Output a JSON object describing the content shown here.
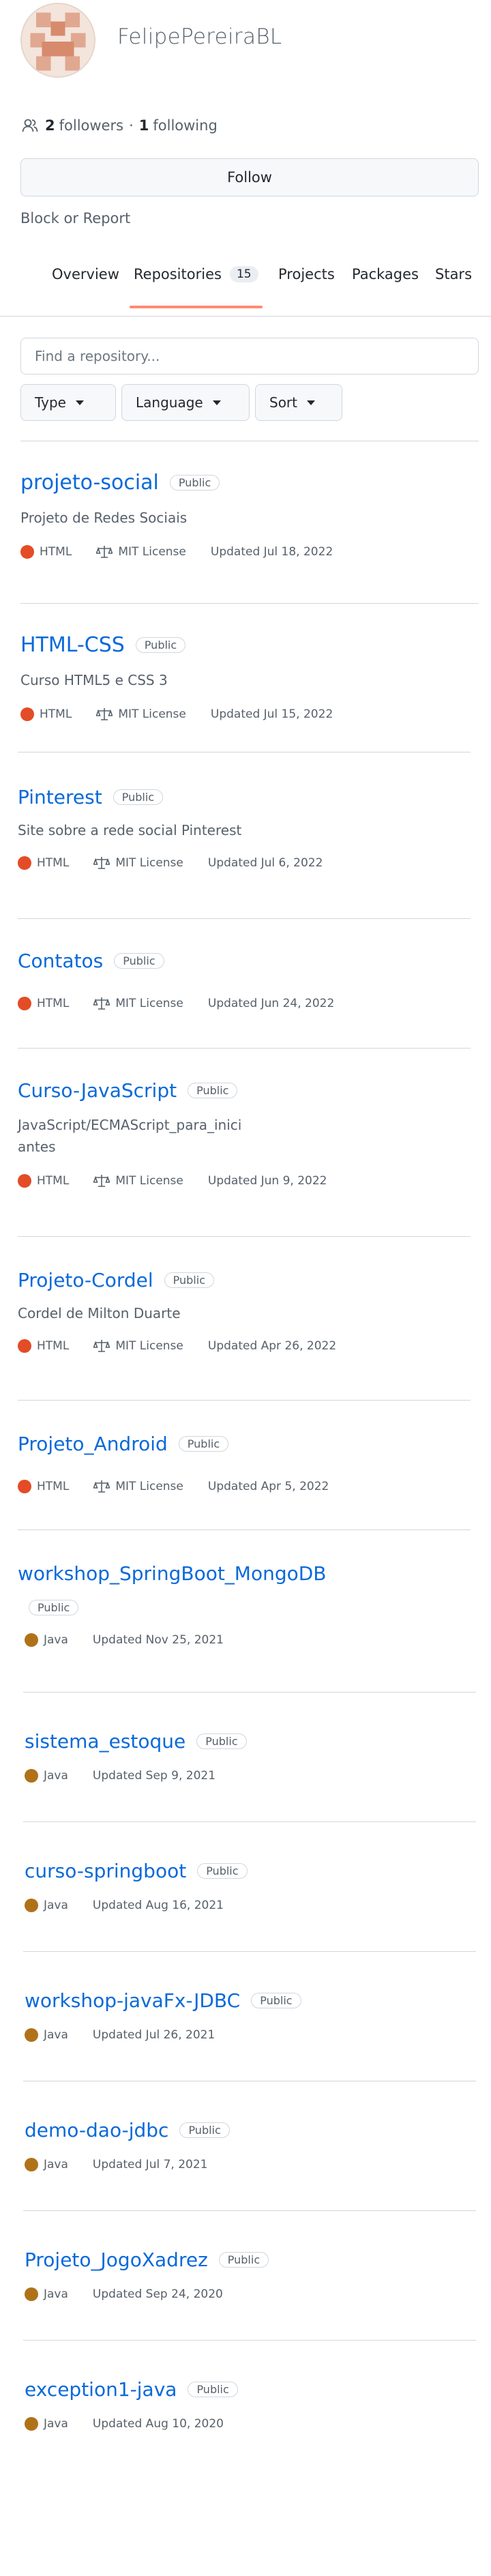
{
  "profile": {
    "username": "FelipePereiraBL",
    "followers_count": "2",
    "followers_label": "followers",
    "following_count": "1",
    "following_label": "following",
    "follow_button": "Follow",
    "block_link": "Block or Report"
  },
  "tabs": [
    {
      "label": "Overview"
    },
    {
      "label": "Repositories",
      "count": "15"
    },
    {
      "label": "Projects"
    },
    {
      "label": "Packages"
    },
    {
      "label": "Stars"
    }
  ],
  "search": {
    "placeholder": "Find a repository..."
  },
  "filters": [
    {
      "label": "Type"
    },
    {
      "label": "Language"
    },
    {
      "label": "Sort"
    }
  ],
  "colors": {
    "accent": "#0969da",
    "html": "#e34c26",
    "java": "#b07219",
    "tab_underline": "#fd8c73"
  },
  "repos": [
    {
      "name": "projeto-social",
      "visibility": "Public",
      "description": "Projeto de Redes Sociais",
      "language": "HTML",
      "license": "MIT License",
      "updated": "Updated Jul 18, 2022"
    },
    {
      "name": "HTML-CSS",
      "visibility": "Public",
      "description": "Curso HTML5 e CSS 3",
      "language": "HTML",
      "license": "MIT License",
      "updated": "Updated Jul 15, 2022"
    },
    {
      "name": "Pinterest",
      "visibility": "Public",
      "description": "Site sobre a rede social Pinterest",
      "language": "HTML",
      "license": "MIT License",
      "updated": "Updated Jul 6, 2022"
    },
    {
      "name": "Contatos",
      "visibility": "Public",
      "description": "",
      "language": "HTML",
      "license": "MIT License",
      "updated": "Updated Jun 24, 2022"
    },
    {
      "name": "Curso-JavaScript",
      "visibility": "Public",
      "description_line1": "JavaScript/ECMAScript_para_inici",
      "description_line2": "antes",
      "language": "HTML",
      "license": "MIT License",
      "updated": "Updated Jun 9, 2022"
    },
    {
      "name": "Projeto-Cordel",
      "visibility": "Public",
      "description": "Cordel de Milton Duarte",
      "language": "HTML",
      "license": "MIT License",
      "updated": "Updated Apr 26, 2022"
    },
    {
      "name": "Projeto_Android",
      "visibility": "Public",
      "description": "",
      "language": "HTML",
      "license": "MIT License",
      "updated": "Updated Apr 5, 2022"
    },
    {
      "name": "workshop_SpringBoot_MongoDB",
      "visibility": "Public",
      "language": "Java",
      "updated": "Updated Nov 25, 2021"
    },
    {
      "name": "sistema_estoque",
      "visibility": "Public",
      "language": "Java",
      "updated": "Updated Sep 9, 2021"
    },
    {
      "name": "curso-springboot",
      "visibility": "Public",
      "language": "Java",
      "updated": "Updated Aug 16, 2021"
    },
    {
      "name": "workshop-javaFx-JDBC",
      "visibility": "Public",
      "language": "Java",
      "updated": "Updated Jul 26, 2021"
    },
    {
      "name": "demo-dao-jdbc",
      "visibility": "Public",
      "language": "Java",
      "updated": "Updated Jul 7, 2021"
    },
    {
      "name": "Projeto_JogoXadrez",
      "visibility": "Public",
      "language": "Java",
      "updated": "Updated Sep 24, 2020"
    },
    {
      "name": "exception1-java",
      "visibility": "Public",
      "language": "Java",
      "updated": "Updated Aug 10, 2020"
    }
  ]
}
